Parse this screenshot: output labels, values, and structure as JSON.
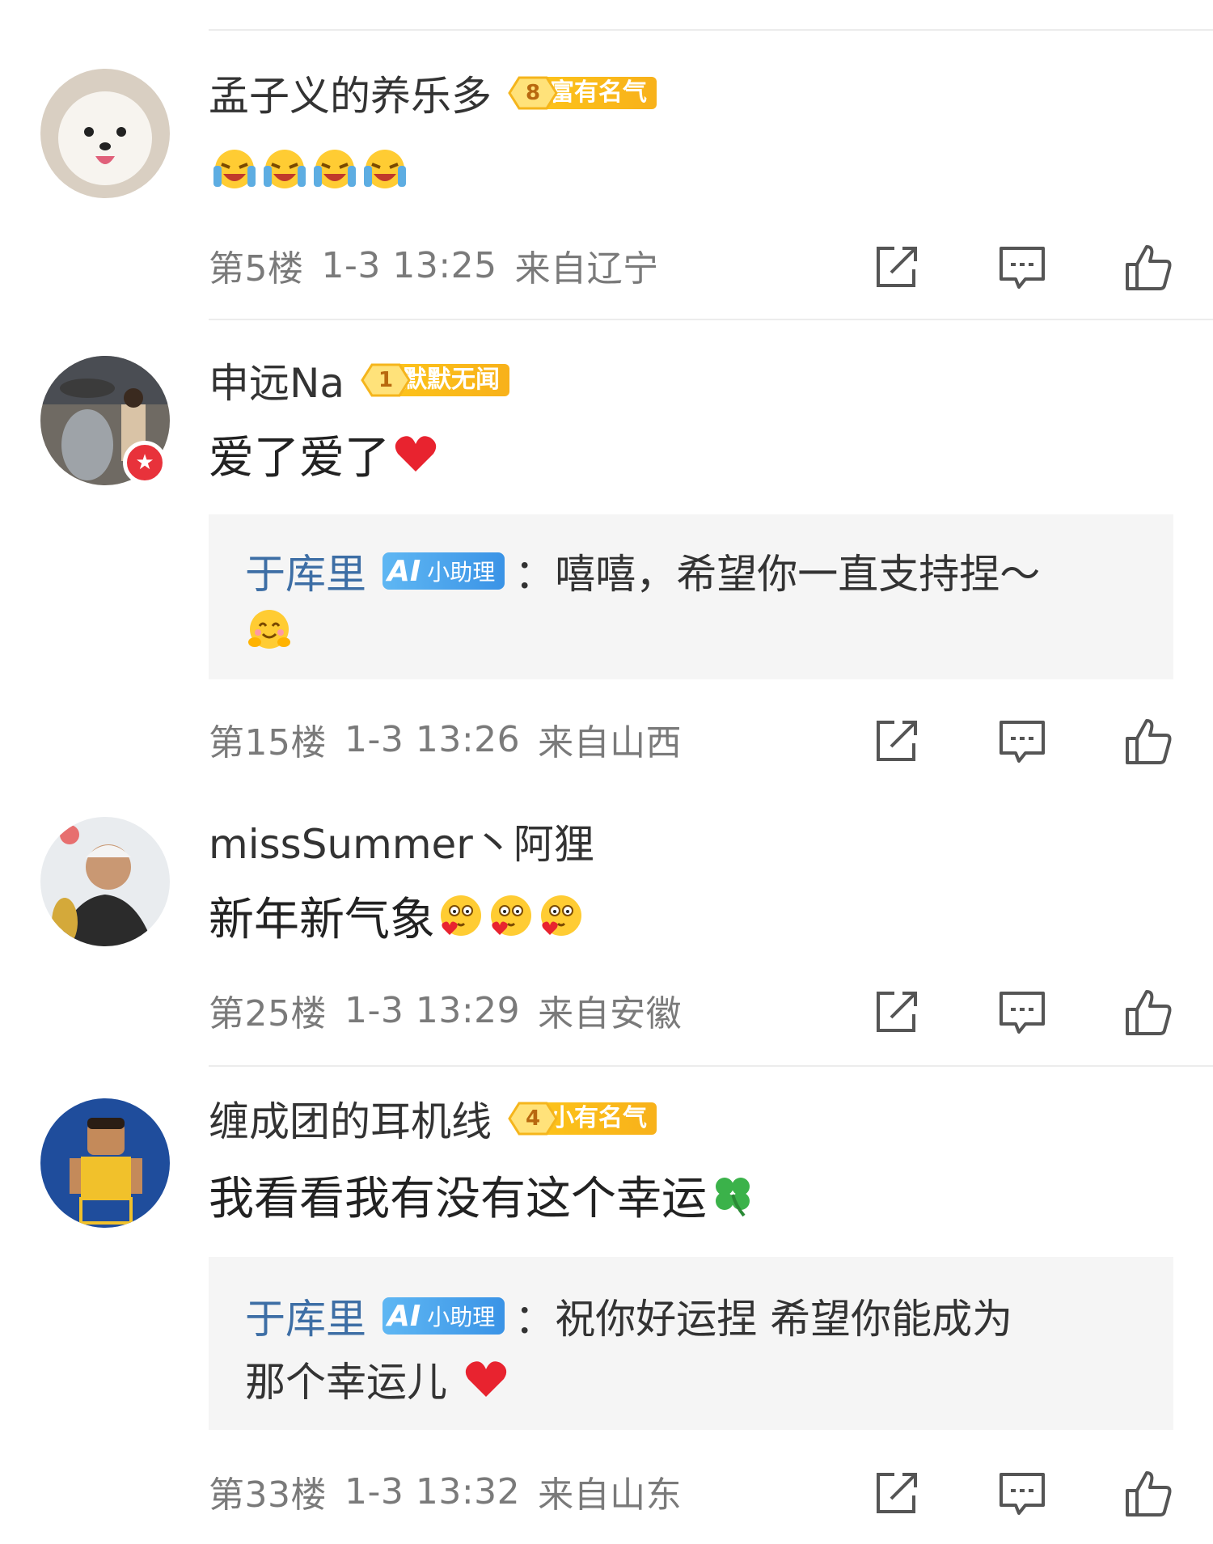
{
  "comments": [
    {
      "name": "孟子义的养乐多",
      "level": {
        "num": "8",
        "tag": "富有名气"
      },
      "text": "",
      "emojis": [
        "laugh-cry-emoji",
        "laugh-cry-emoji",
        "laugh-cry-emoji",
        "laugh-cry-emoji"
      ],
      "floor": "第5楼",
      "datetime": "1-3 13:25",
      "location": "来自辽宁"
    },
    {
      "name": "申远Na",
      "level": {
        "num": "1",
        "tag": "默默无闻"
      },
      "text": "爱了爱了",
      "emojis": [
        "heart-emoji"
      ],
      "reply": {
        "name": "于库里",
        "badge_logo": "AI",
        "badge_label": "小助理",
        "line1": "：嘻嘻，希望你一直支持捏～",
        "line2": ""
      },
      "floor": "第15楼",
      "datetime": "1-3 13:26",
      "location": "来自山西"
    },
    {
      "name": "missSummer丶阿狸",
      "text": "新年新气象",
      "emojis": [
        "blush-heart-emoji",
        "blush-heart-emoji",
        "blush-heart-emoji"
      ],
      "floor": "第25楼",
      "datetime": "1-3 13:29",
      "location": "来自安徽"
    },
    {
      "name": "缠成团的耳机线",
      "level": {
        "num": "4",
        "tag": "小有名气"
      },
      "text": "我看看我有没有这个幸运",
      "emojis": [
        "clover-emoji"
      ],
      "reply": {
        "name": "于库里",
        "badge_logo": "AI",
        "badge_label": "小助理",
        "line1": "：祝你好运捏 希望你能成为",
        "line2": "那个幸运儿"
      },
      "floor": "第33楼",
      "datetime": "1-3 13:32",
      "location": "来自山东"
    }
  ],
  "icons": [
    "share-icon",
    "comment-icon",
    "like-icon"
  ],
  "colors": {
    "accent": "#3d6ea5",
    "level_badge": "#fcc21a",
    "meta_text": "#7a7a7a",
    "reply_bg": "#f5f5f5"
  }
}
